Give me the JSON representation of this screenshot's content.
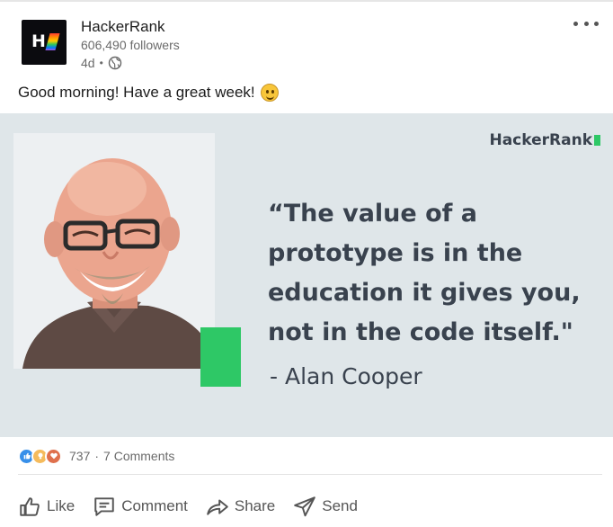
{
  "post": {
    "company_name": "HackerRank",
    "followers": "606,490 followers",
    "age": "4d",
    "meta_separator": "•",
    "caption": "Good morning! Have a great week!",
    "logo_text": "H"
  },
  "media": {
    "brand_text": "HackerRank",
    "quote": "“The value of a prototype is in the education it gives you, not in the code itself.\"",
    "author": "- Alan Cooper",
    "colors": {
      "background": "#dfe6e9",
      "accent": "#2ec866",
      "text": "#39424e"
    }
  },
  "social": {
    "reaction_count": "737",
    "separator": "·",
    "comments": "7 Comments",
    "reactions": [
      "like-icon",
      "insightful-icon",
      "love-icon"
    ]
  },
  "actions": {
    "like": "Like",
    "comment": "Comment",
    "share": "Share",
    "send": "Send"
  }
}
